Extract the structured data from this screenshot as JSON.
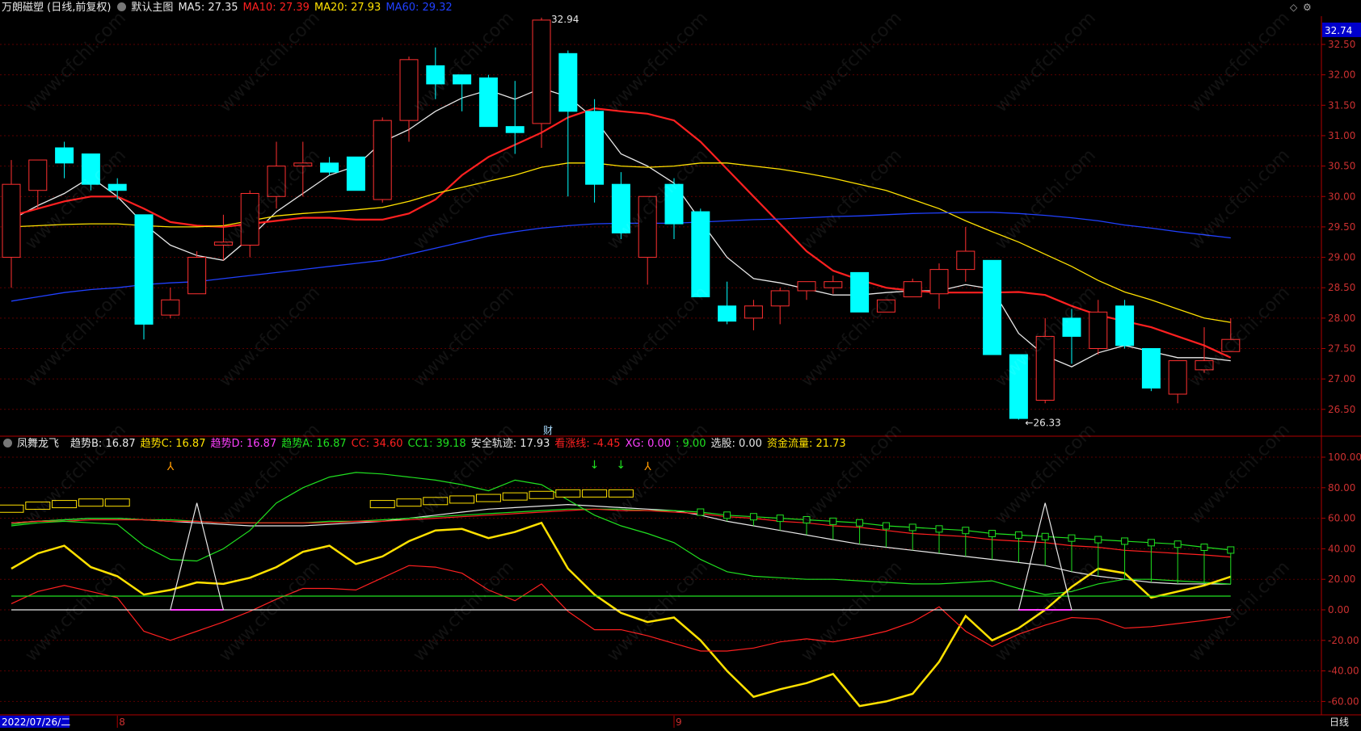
{
  "main_panel": {
    "stock_title": "万朗磁塑 (日线,前复权)",
    "view_label": "默认主图",
    "ma_legend": [
      {
        "label": "MA5: 27.35",
        "color": "#e8e8e8"
      },
      {
        "label": "MA10: 27.39",
        "color": "#ff2020"
      },
      {
        "label": "MA20: 27.93",
        "color": "#ffe100"
      },
      {
        "label": "MA60: 29.32",
        "color": "#2040ff"
      }
    ],
    "current_price_tag": "32.74",
    "high_label": "32.94",
    "low_label": "26.33",
    "event_marker": "财",
    "y_ticks": [
      "32.50",
      "32.00",
      "31.50",
      "31.00",
      "30.50",
      "30.00",
      "29.50",
      "29.00",
      "28.50",
      "28.00",
      "27.50",
      "27.00",
      "26.50"
    ]
  },
  "indicator_panel": {
    "name": "凤舞龙飞",
    "legend": [
      {
        "label": "趋势B: 16.87",
        "color": "#e8e8e8"
      },
      {
        "label": "趋势C: 16.87",
        "color": "#ffe100"
      },
      {
        "label": "趋势D: 16.87",
        "color": "#ff40ff"
      },
      {
        "label": "趋势A: 16.87",
        "color": "#20e020"
      },
      {
        "label": "CC: 34.60",
        "color": "#ff2020"
      },
      {
        "label": "CC1: 39.18",
        "color": "#20e020"
      },
      {
        "label": "安全轨迹: 17.93",
        "color": "#e8e8e8"
      },
      {
        "label": "看涨线: -4.45",
        "color": "#ff2020"
      },
      {
        "label": "XG: 0.00",
        "color": "#ff40ff"
      },
      {
        "label": ": 9.00",
        "color": "#20e020"
      },
      {
        "label": "选股: 0.00",
        "color": "#e8e8e8"
      },
      {
        "label": "资金流量: 21.73",
        "color": "#ffe100"
      }
    ],
    "y_ticks": [
      "100.00",
      "80.00",
      "60.00",
      "40.00",
      "20.00",
      "0.00",
      "-20.00",
      "-40.00",
      "-60.00"
    ]
  },
  "bottom_bar": {
    "date_label": "2022/07/26/二",
    "month_marks": [
      "8",
      "9"
    ],
    "period_label": "日线"
  },
  "watermark": "www.cfchi.com",
  "colors": {
    "up": "#ff3030",
    "down": "#00ffff",
    "grid": "#5a0000",
    "axis": "#b00000",
    "background": "#000000"
  },
  "chart_data": [
    {
      "type": "candlestick",
      "ylim": [
        26.0,
        33.0
      ],
      "candles": [
        {
          "o": 29.0,
          "h": 30.6,
          "l": 28.5,
          "c": 30.2
        },
        {
          "o": 30.1,
          "h": 30.6,
          "l": 29.8,
          "c": 30.6
        },
        {
          "o": 30.8,
          "h": 30.9,
          "l": 30.3,
          "c": 30.55
        },
        {
          "o": 30.7,
          "h": 30.7,
          "l": 30.1,
          "c": 30.2
        },
        {
          "o": 30.2,
          "h": 30.3,
          "l": 29.95,
          "c": 30.1
        },
        {
          "o": 29.7,
          "h": 29.7,
          "l": 27.65,
          "c": 27.9
        },
        {
          "o": 28.05,
          "h": 28.5,
          "l": 28.0,
          "c": 28.3
        },
        {
          "o": 28.4,
          "h": 29.1,
          "l": 28.4,
          "c": 29.0
        },
        {
          "o": 29.2,
          "h": 29.7,
          "l": 28.95,
          "c": 29.25
        },
        {
          "o": 29.2,
          "h": 30.1,
          "l": 29.0,
          "c": 30.05
        },
        {
          "o": 30.0,
          "h": 30.9,
          "l": 29.8,
          "c": 30.5
        },
        {
          "o": 30.5,
          "h": 30.9,
          "l": 30.0,
          "c": 30.55
        },
        {
          "o": 30.55,
          "h": 30.65,
          "l": 30.35,
          "c": 30.4
        },
        {
          "o": 30.65,
          "h": 30.65,
          "l": 30.1,
          "c": 30.1
        },
        {
          "o": 29.95,
          "h": 31.3,
          "l": 29.9,
          "c": 31.25
        },
        {
          "o": 31.25,
          "h": 32.3,
          "l": 30.9,
          "c": 32.25
        },
        {
          "o": 32.15,
          "h": 32.45,
          "l": 31.6,
          "c": 31.85
        },
        {
          "o": 32.0,
          "h": 32.0,
          "l": 31.4,
          "c": 31.85
        },
        {
          "o": 31.95,
          "h": 32.0,
          "l": 31.15,
          "c": 31.15
        },
        {
          "o": 31.15,
          "h": 31.9,
          "l": 30.7,
          "c": 31.05
        },
        {
          "o": 31.2,
          "h": 32.94,
          "l": 30.8,
          "c": 32.9
        },
        {
          "o": 32.35,
          "h": 32.4,
          "l": 30.0,
          "c": 31.4
        },
        {
          "o": 31.4,
          "h": 31.6,
          "l": 29.9,
          "c": 30.2
        },
        {
          "o": 30.2,
          "h": 30.4,
          "l": 29.3,
          "c": 29.4
        },
        {
          "o": 29.0,
          "h": 30.0,
          "l": 28.55,
          "c": 30.0
        },
        {
          "o": 30.2,
          "h": 30.3,
          "l": 29.3,
          "c": 29.55
        },
        {
          "o": 29.75,
          "h": 29.8,
          "l": 28.35,
          "c": 28.35
        },
        {
          "o": 28.2,
          "h": 28.6,
          "l": 27.9,
          "c": 27.95
        },
        {
          "o": 28.0,
          "h": 28.3,
          "l": 27.8,
          "c": 28.2
        },
        {
          "o": 28.2,
          "h": 28.5,
          "l": 27.9,
          "c": 28.45
        },
        {
          "o": 28.45,
          "h": 28.6,
          "l": 28.3,
          "c": 28.6
        },
        {
          "o": 28.5,
          "h": 28.7,
          "l": 28.4,
          "c": 28.6
        },
        {
          "o": 28.75,
          "h": 28.75,
          "l": 28.1,
          "c": 28.1
        },
        {
          "o": 28.1,
          "h": 28.3,
          "l": 28.1,
          "c": 28.3
        },
        {
          "o": 28.35,
          "h": 28.65,
          "l": 28.35,
          "c": 28.6
        },
        {
          "o": 28.4,
          "h": 28.9,
          "l": 28.15,
          "c": 28.8
        },
        {
          "o": 28.8,
          "h": 29.5,
          "l": 28.6,
          "c": 29.1
        },
        {
          "o": 28.95,
          "h": 28.95,
          "l": 27.4,
          "c": 27.4
        },
        {
          "o": 27.4,
          "h": 27.4,
          "l": 26.33,
          "c": 26.35
        },
        {
          "o": 26.65,
          "h": 28.0,
          "l": 26.6,
          "c": 27.7
        },
        {
          "o": 28.0,
          "h": 28.15,
          "l": 27.25,
          "c": 27.7
        },
        {
          "o": 27.5,
          "h": 28.3,
          "l": 27.4,
          "c": 28.1
        },
        {
          "o": 28.2,
          "h": 28.3,
          "l": 27.5,
          "c": 27.55
        },
        {
          "o": 27.5,
          "h": 27.5,
          "l": 26.8,
          "c": 26.85
        },
        {
          "o": 26.75,
          "h": 27.3,
          "l": 26.6,
          "c": 27.3
        },
        {
          "o": 27.15,
          "h": 27.85,
          "l": 27.1,
          "c": 27.3
        },
        {
          "o": 27.45,
          "h": 28.0,
          "l": 27.45,
          "c": 27.65
        }
      ],
      "series": [
        {
          "name": "MA5",
          "color": "#e8e8e8",
          "values": [
            29.62,
            29.85,
            30.05,
            30.32,
            30.0,
            29.55,
            29.2,
            29.03,
            28.95,
            29.32,
            29.75,
            30.05,
            30.35,
            30.5,
            30.9,
            31.1,
            31.4,
            31.62,
            31.75,
            31.6,
            31.78,
            31.64,
            31.28,
            30.7,
            30.5,
            30.22,
            29.6,
            29.0,
            28.65,
            28.58,
            28.48,
            28.38,
            28.38,
            28.42,
            28.45,
            28.45,
            28.55,
            28.48,
            27.75,
            27.38,
            27.2,
            27.43,
            27.55,
            27.45,
            27.35,
            27.35,
            27.3
          ]
        },
        {
          "name": "MA10",
          "color": "#ff2020",
          "values": [
            29.68,
            29.8,
            29.92,
            30.0,
            30.0,
            29.8,
            29.58,
            29.52,
            29.5,
            29.55,
            29.6,
            29.65,
            29.65,
            29.62,
            29.62,
            29.72,
            29.95,
            30.35,
            30.65,
            30.85,
            31.05,
            31.3,
            31.45,
            31.4,
            31.36,
            31.25,
            30.9,
            30.45,
            30.0,
            29.55,
            29.1,
            28.78,
            28.63,
            28.5,
            28.45,
            28.42,
            28.42,
            28.42,
            28.43,
            28.38,
            28.2,
            28.05,
            27.95,
            27.85,
            27.7,
            27.55,
            27.35
          ]
        },
        {
          "name": "MA20",
          "color": "#ffe100",
          "values": [
            29.5,
            29.52,
            29.54,
            29.55,
            29.55,
            29.52,
            29.5,
            29.5,
            29.52,
            29.6,
            29.68,
            29.72,
            29.75,
            29.78,
            29.82,
            29.92,
            30.05,
            30.15,
            30.25,
            30.35,
            30.48,
            30.55,
            30.55,
            30.5,
            30.48,
            30.5,
            30.55,
            30.55,
            30.5,
            30.45,
            30.38,
            30.3,
            30.2,
            30.1,
            29.95,
            29.8,
            29.6,
            29.42,
            29.25,
            29.05,
            28.85,
            28.62,
            28.43,
            28.3,
            28.15,
            28.0,
            27.93
          ]
        },
        {
          "name": "MA60",
          "color": "#2040ff",
          "values": [
            28.28,
            28.35,
            28.42,
            28.47,
            28.5,
            28.55,
            28.58,
            28.6,
            28.65,
            28.7,
            28.75,
            28.8,
            28.85,
            28.9,
            28.95,
            29.05,
            29.15,
            29.25,
            29.35,
            29.42,
            29.48,
            29.52,
            29.55,
            29.56,
            29.56,
            29.56,
            29.58,
            29.6,
            29.62,
            29.63,
            29.65,
            29.67,
            29.68,
            29.7,
            29.72,
            29.73,
            29.74,
            29.74,
            29.72,
            29.69,
            29.65,
            29.6,
            29.53,
            29.48,
            29.42,
            29.37,
            29.32
          ]
        }
      ]
    },
    {
      "type": "line",
      "ylim": [
        -60,
        110
      ],
      "series": [
        {
          "name": "趋势B",
          "color": "#e8e8e8",
          "values": [
            57,
            58,
            59,
            60,
            60,
            59,
            58,
            57,
            56,
            55,
            55,
            55,
            56,
            57,
            58,
            60,
            62,
            64,
            66,
            67,
            68,
            69,
            68,
            67,
            66,
            65,
            62,
            58,
            55,
            52,
            49,
            46,
            43,
            41,
            39,
            37,
            35,
            33,
            31,
            29,
            25,
            22,
            20,
            18,
            17,
            17,
            16.87
          ]
        },
        {
          "name": "CC1",
          "color": "#20e020",
          "values": [
            56,
            58,
            59,
            60,
            60,
            59,
            59,
            58,
            57,
            57,
            57,
            57,
            58,
            58,
            59,
            60,
            61,
            62,
            63,
            64,
            65,
            66,
            66,
            66,
            65,
            65,
            64,
            62,
            61,
            60,
            59,
            58,
            57,
            55,
            54,
            53,
            52,
            50,
            49,
            48,
            47,
            46,
            45,
            44,
            43,
            41,
            39.18
          ]
        },
        {
          "name": "CC",
          "color": "#ff2020",
          "values": [
            57,
            58,
            58,
            59,
            59,
            59,
            58,
            58,
            57,
            57,
            57,
            57,
            57,
            58,
            58,
            59,
            60,
            61,
            62,
            63,
            64,
            65,
            66,
            65,
            65,
            64,
            63,
            61,
            60,
            58,
            57,
            55,
            54,
            52,
            50,
            49,
            48,
            46,
            45,
            44,
            42,
            41,
            39,
            38,
            37,
            36,
            34.6
          ]
        },
        {
          "name": "趋势A",
          "color": "#20e020",
          "values": [
            55,
            57,
            58,
            57,
            56,
            42,
            33,
            32,
            40,
            52,
            70,
            80,
            87,
            90,
            89,
            87,
            85,
            82,
            78,
            85,
            82,
            72,
            62,
            55,
            50,
            44,
            33,
            25,
            22,
            21,
            20,
            20,
            19,
            18,
            17,
            17,
            18,
            19,
            14,
            10,
            12,
            17,
            20,
            20,
            19,
            18,
            16.87
          ]
        },
        {
          "name": "资金流量",
          "color": "#ffe100",
          "values": [
            27,
            37,
            42,
            28,
            22,
            10,
            13,
            18,
            17,
            21,
            28,
            38,
            42,
            30,
            35,
            45,
            52,
            53,
            47,
            51,
            57,
            27,
            10,
            -2,
            -8,
            -5,
            -20,
            -40,
            -57,
            -52,
            -48,
            -42,
            -63,
            -60,
            -55,
            -34,
            -4,
            -20,
            -12,
            0,
            15,
            27,
            24,
            8,
            12,
            16,
            21.73
          ]
        },
        {
          "name": "看涨线",
          "color": "#ff2020",
          "values": [
            4,
            12,
            16,
            12,
            8,
            -14,
            -20,
            -14,
            -8,
            -1,
            7,
            14,
            14,
            13,
            21,
            29,
            28,
            24,
            13,
            6,
            17,
            -1,
            -13,
            -13,
            -17,
            -22,
            -27,
            -27,
            -25,
            -21,
            -19,
            -21,
            -18,
            -14,
            -8,
            2,
            -14,
            -24,
            -16,
            -10,
            -5,
            -6,
            -12,
            -11,
            -9,
            -7,
            -4.45
          ]
        },
        {
          "name": "安全轨迹",
          "color": "#e8e8e8",
          "values": [
            0,
            0,
            0,
            0,
            0,
            0,
            0,
            0,
            0,
            0,
            0,
            0,
            0,
            0,
            0,
            0,
            0,
            0,
            0,
            0,
            0,
            0,
            0,
            0,
            0,
            0,
            0,
            0,
            0,
            0,
            0,
            0,
            0,
            0,
            0,
            0,
            0,
            0,
            0,
            0,
            0,
            0,
            0,
            0,
            0,
            0,
            0
          ]
        },
        {
          "name": "基准线",
          "color": "#20e020",
          "values": [
            9,
            9,
            9,
            9,
            9,
            9,
            9,
            9,
            9,
            9,
            9,
            9,
            9,
            9,
            9,
            9,
            9,
            9,
            9,
            9,
            9,
            9,
            9,
            9,
            9,
            9,
            9,
            9,
            9,
            9,
            9,
            9,
            9,
            9,
            9,
            9,
            9,
            9,
            9,
            9,
            9,
            9,
            9,
            9,
            9,
            9,
            9
          ]
        }
      ],
      "spikes": [
        {
          "index": 7,
          "value": 70
        },
        {
          "index": 39,
          "value": 70
        }
      ]
    }
  ]
}
